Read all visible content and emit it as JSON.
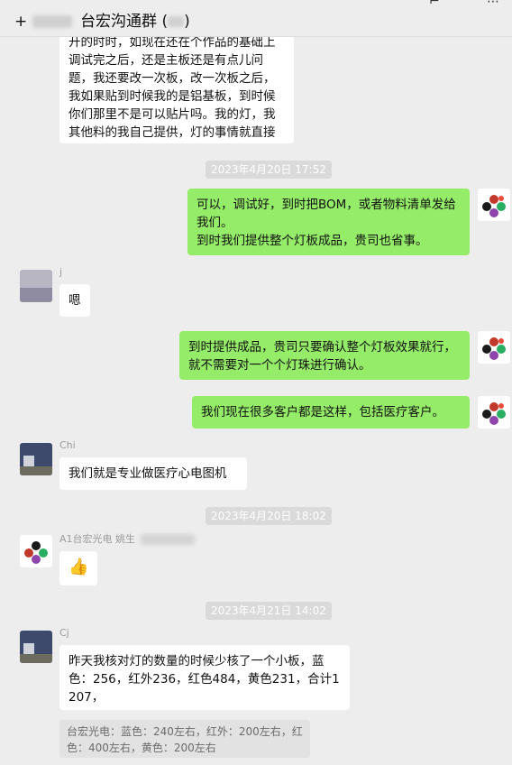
{
  "window": {
    "title": "台宏沟通群",
    "title_prefix": "+"
  },
  "messages": [
    {
      "dir": "in",
      "text": "开的时时，如现在还在个作品的基础上调试完之后，还是主板还是有点儿问题，我还要改一次板，改一次板之后，我如果贴到时候我的是铝基板，到时候你们那里不是可以贴片吗。我的灯，我其他料的我自己提供，灯的事情就直接你们来安排贴，到时候贴片费或者干嘛，你们报价给我就行了。"
    },
    {
      "time": "2023年4月20日 17:52"
    },
    {
      "dir": "out",
      "text": "可以，调试好，到时把BOM，或者物料清单发给我们。\n到时我们提供整个灯板成品，贵司也省事。"
    },
    {
      "dir": "in",
      "sender": "j",
      "text": "嗯"
    },
    {
      "dir": "out",
      "text": "到时提供成品，贵司只要确认整个灯板效果就行，就不需要对一个个灯珠进行确认。"
    },
    {
      "dir": "out",
      "text": "我们现在很多客户都是这样，包括医疗客户。"
    },
    {
      "dir": "in",
      "sender": "Chi",
      "text": "我们就是专业做医疗心电图机"
    },
    {
      "time": "2023年4月20日 18:02"
    },
    {
      "dir": "in",
      "sender": "A1台宏光电 姚生",
      "emoji": "👍"
    },
    {
      "time": "2023年4月21日 14:02"
    },
    {
      "dir": "in",
      "sender": "Cj",
      "text": "昨天我核对灯的数量的时候少核了一个小板，蓝色：256，红外236，红色484，黄色231，合计1207，",
      "quote": "台宏光电：蓝色：240左右，红外：200左右，红色：400左右，黄色：200左右"
    }
  ]
}
